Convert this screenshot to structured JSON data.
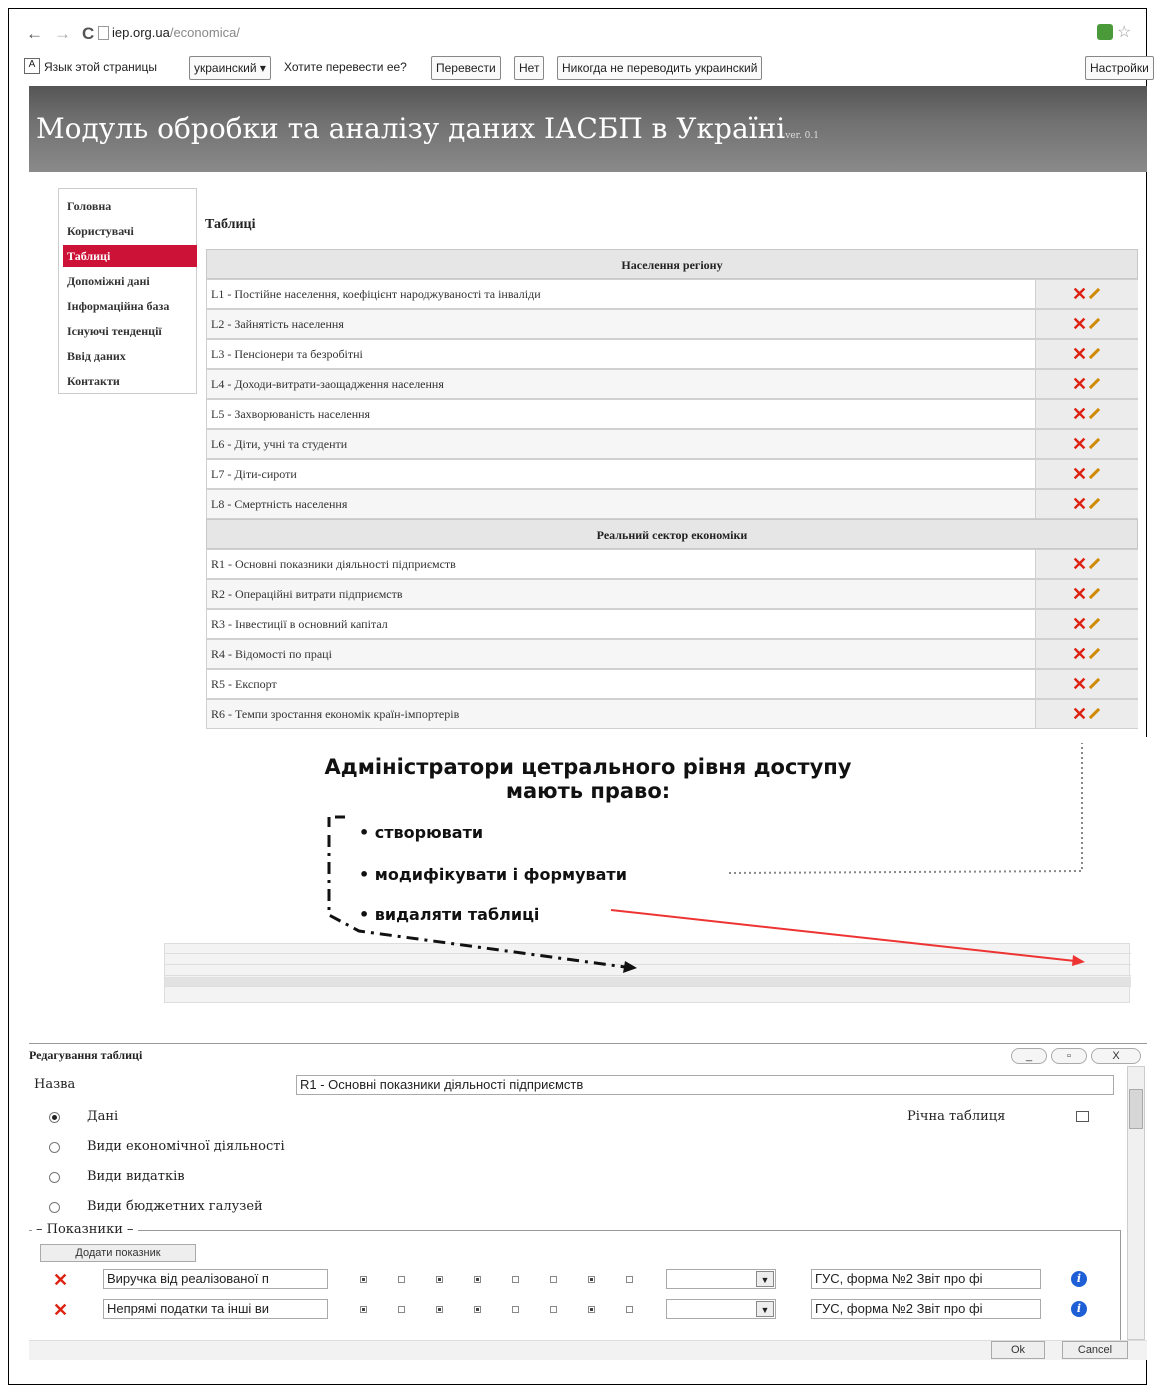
{
  "browser": {
    "back": "←",
    "forward": "→",
    "reload": "C",
    "url_host": "iep.org.ua",
    "url_path": "/economica/",
    "translate": {
      "prompt": "Язык этой страницы",
      "language": "украинский ▾",
      "question": "Хотите перевести ее?",
      "translate_btn": "Перевести",
      "no_btn": "Нет",
      "never_btn": "Никогда не переводить украинский",
      "settings_btn": "Настройки"
    }
  },
  "site": {
    "title": "Модуль обробки та аналізу даних ІАСБП в Україні",
    "version": "ver. 0.1"
  },
  "sidebar": {
    "items": [
      {
        "label": "Головна"
      },
      {
        "label": "Користувачі"
      },
      {
        "label": "Таблиці"
      },
      {
        "label": "Допоміжні дані"
      },
      {
        "label": "Інформаційна база"
      },
      {
        "label": "Існуючі тенденції"
      },
      {
        "label": "Ввід даних"
      },
      {
        "label": "Контакти"
      }
    ],
    "active_index": 2
  },
  "main": {
    "heading": "Таблиці",
    "sections": [
      {
        "title": "Населення регіону",
        "rows": [
          "L1 - Постійне населення, коефіцієнт народжуваності та інваліди",
          "L2 - Зайнятість населення",
          "L3 - Пенсіонери та безробітні",
          "L4 - Доходи-витрати-заощадження населення",
          "L5 - Захворюваність населення",
          "L6 - Діти, учні та студенти",
          "L7 - Діти-сироти",
          "L8 - Смертність населення"
        ]
      },
      {
        "title": "Реальний сектор економіки",
        "rows": [
          "R1 - Основні показники діяльності підприємств",
          "R2 - Операційні витрати підприємств",
          "R3 - Інвестиції в основний капітал",
          "R4 - Відомості по праці",
          "R5 - Експорт",
          "R6 - Темпи зростання економік країн-імпортерів"
        ]
      }
    ],
    "delete_icon": "close-icon",
    "edit_icon": "pencil-icon"
  },
  "illustration": {
    "title_line1": "Адміністратори цетрального рівня доступу",
    "title_line2": "мають право:",
    "items": [
      "• створювати",
      "• модифікувати і формувати",
      "• видаляти таблиці"
    ]
  },
  "dialog": {
    "title": "Редагування таблиці",
    "window_btns": [
      "_",
      "▫",
      "X"
    ],
    "name_label": "Назва",
    "name_value": "R1 - Основні показники діяльності підприємств",
    "radios": [
      "Дані",
      "Види економічної діяльності",
      "Види видатків",
      "Види бюджетних галузей"
    ],
    "checked_radio": 0,
    "annual_label": "Річна таблиця",
    "indicators_legend": "Показники",
    "add_btn": "Додати показник",
    "indicators": [
      {
        "name": "Виручка від реалізованої п",
        "source": "ГУС, форма №2 Звіт про фі"
      },
      {
        "name": "Непрямі податки та інші ви",
        "source": "ГУС, форма №2 Звіт про фі"
      }
    ],
    "ok": "Ok",
    "cancel": "Cancel"
  }
}
